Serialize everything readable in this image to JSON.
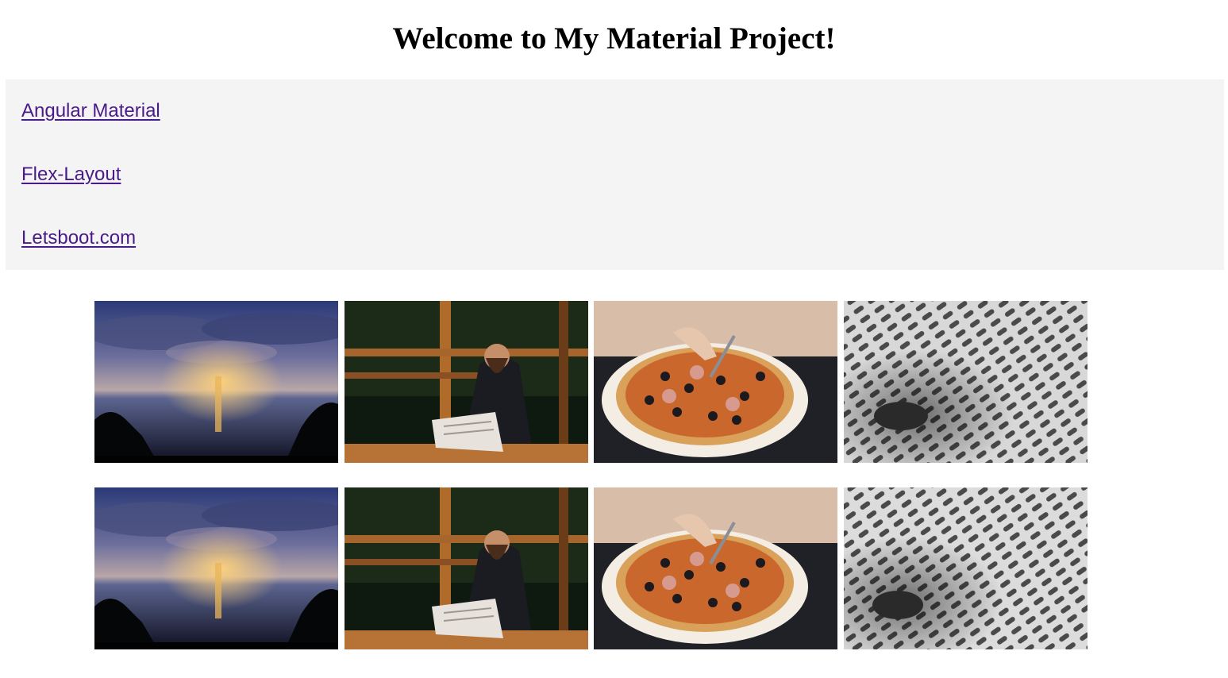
{
  "page": {
    "title": "Welcome to My Material Project!"
  },
  "nav": {
    "links": [
      {
        "label": "Angular Material"
      },
      {
        "label": "Flex-Layout"
      },
      {
        "label": "Letsboot.com"
      }
    ]
  },
  "gallery": {
    "rows": [
      {
        "images": [
          "sunset-sea-image",
          "man-reading-newspaper-image",
          "pizza-image",
          "abstract-architecture-image"
        ]
      },
      {
        "images": [
          "sunset-sea-image",
          "man-reading-newspaper-image",
          "pizza-image",
          "abstract-architecture-image"
        ]
      }
    ]
  },
  "colors": {
    "link": "#4a1a8a",
    "panel_background": "#f4f4f4",
    "title": "#000000"
  }
}
